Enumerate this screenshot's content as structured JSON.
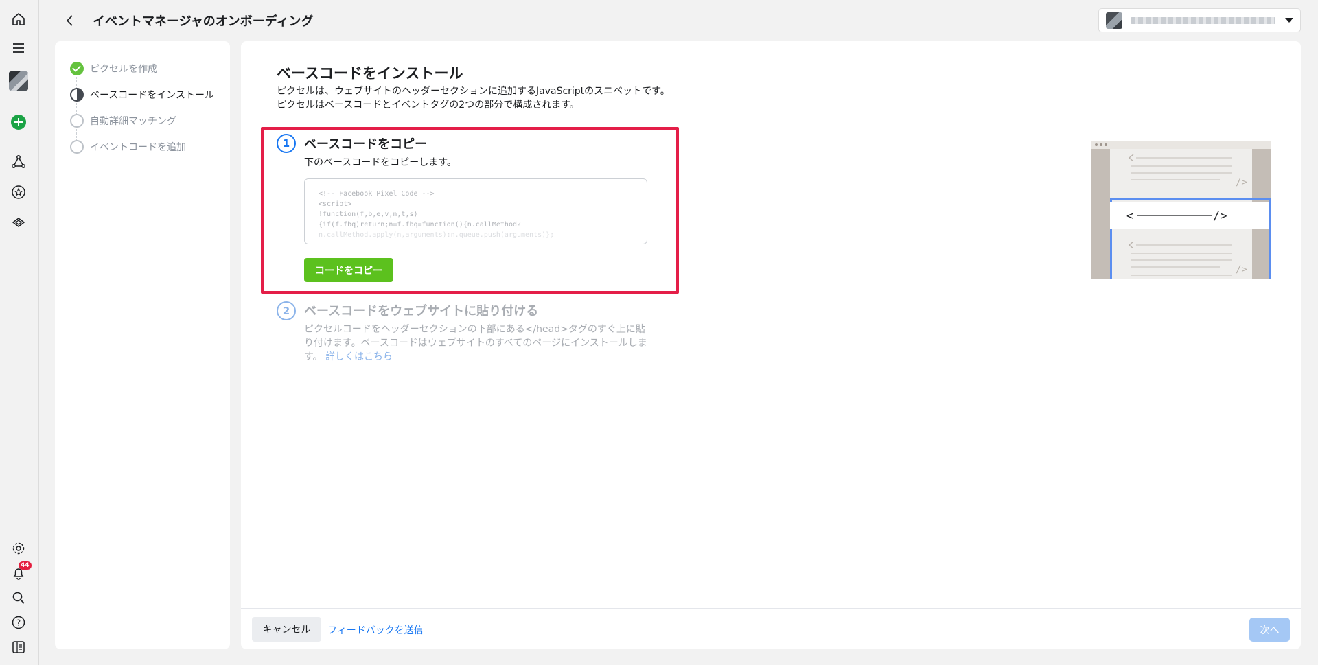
{
  "header": {
    "title": "イベントマネージャのオンボーディング"
  },
  "rail": {
    "notification_count": "44"
  },
  "steps": [
    {
      "label": "ピクセルを作成",
      "state": "done"
    },
    {
      "label": "ベースコードをインストール",
      "state": "active"
    },
    {
      "label": "自動詳細マッチング",
      "state": "todo"
    },
    {
      "label": "イベントコードを追加",
      "state": "todo"
    }
  ],
  "main": {
    "title": "ベースコードをインストール",
    "description_line1": "ピクセルは、ウェブサイトのヘッダーセクションに追加するJavaScriptのスニペットです。",
    "description_line2": "ピクセルはベースコードとイベントタグの2つの部分で構成されます。",
    "step1": {
      "number": "1",
      "title": "ベースコードをコピー",
      "subtitle": "下のベースコードをコピーします。",
      "code_lines": [
        "<!-- Facebook Pixel Code -->",
        "<script>",
        "!function(f,b,e,v,n,t,s)",
        "{if(f.fbq)return;n=f.fbq=function(){n.callMethod?",
        "n.callMethod.apply(n,arguments):n.queue.push(arguments)};"
      ],
      "copy_button": "コードをコピー"
    },
    "step2": {
      "number": "2",
      "title": "ベースコードをウェブサイトに貼り付ける",
      "description": "ピクセルコードをヘッダーセクションの下部にある</head>タグのすぐ上に貼り付けます。ベースコードはウェブサイトのすべてのページにインストールします。",
      "link": "詳しくはこちら"
    }
  },
  "footer": {
    "cancel": "キャンセル",
    "feedback": "フィードバックを送信",
    "next": "次へ"
  },
  "colors": {
    "accent": "#1877f2",
    "green": "#5cc11e",
    "highlight": "#e41e48"
  }
}
